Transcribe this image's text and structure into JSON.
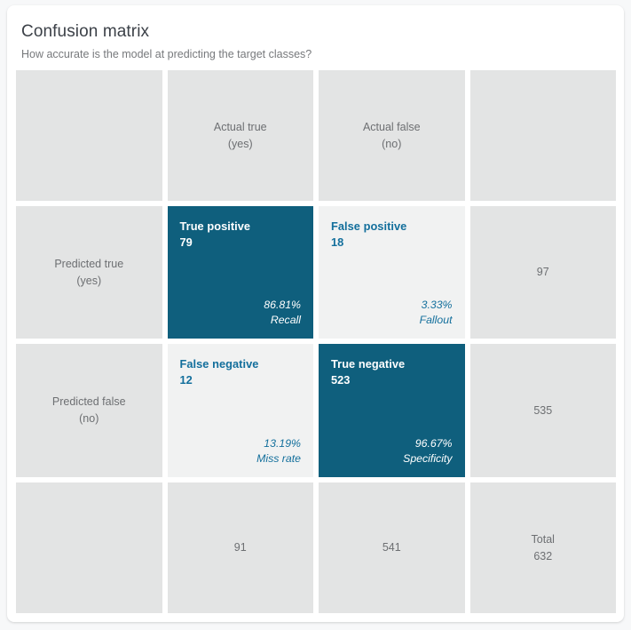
{
  "card": {
    "title": "Confusion matrix",
    "subtitle": "How accurate is the model at predicting the target classes?"
  },
  "headers": {
    "actual_true": "Actual true\n(yes)",
    "actual_false": "Actual false\n(no)",
    "predicted_true": "Predicted true\n(yes)",
    "predicted_false": "Predicted false\n(no)"
  },
  "quadrants": {
    "true_positive": {
      "name": "True positive",
      "count": "79",
      "percent": "86.81%",
      "metric": "Recall"
    },
    "false_positive": {
      "name": "False positive",
      "count": "18",
      "percent": "3.33%",
      "metric": "Fallout"
    },
    "false_negative": {
      "name": "False negative",
      "count": "12",
      "percent": "13.19%",
      "metric": "Miss rate"
    },
    "true_negative": {
      "name": "True negative",
      "count": "523",
      "percent": "96.67%",
      "metric": "Specificity"
    }
  },
  "totals": {
    "row_predicted_true": "97",
    "row_predicted_false": "535",
    "col_actual_true": "91",
    "col_actual_false": "541",
    "grand_total": "Total\n632"
  },
  "colors": {
    "accent_fill": "#0f5f7d",
    "accent_text": "#136f9c",
    "label_cell": "#e3e4e4",
    "hollow_cell": "#f1f2f2",
    "card_background": "#ffffff",
    "page_background": "#f7f8f9"
  },
  "chart_data": {
    "type": "table",
    "title": "Confusion matrix",
    "subtitle": "How accurate is the model at predicting the target classes?",
    "columns": [
      "",
      "Actual true (yes)",
      "Actual false (no)",
      ""
    ],
    "rows": [
      [
        "Predicted true (yes)",
        79,
        18,
        97
      ],
      [
        "Predicted false (no)",
        12,
        523,
        535
      ],
      [
        "",
        91,
        541,
        632
      ]
    ],
    "cells": {
      "true_positive": 79,
      "false_positive": 18,
      "false_negative": 12,
      "true_negative": 523
    },
    "metrics": {
      "recall": 86.81,
      "fallout": 3.33,
      "miss_rate": 13.19,
      "specificity": 96.67
    },
    "totals": {
      "predicted_true": 97,
      "predicted_false": 535,
      "actual_true": 91,
      "actual_false": 541,
      "total": 632
    }
  }
}
